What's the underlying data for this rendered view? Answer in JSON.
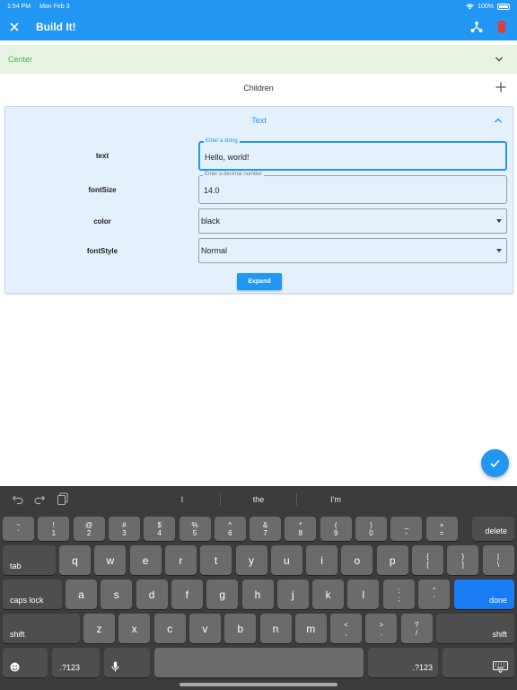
{
  "status_bar": {
    "time": "1:54 PM",
    "date": "Mon Feb 3",
    "battery": "100%"
  },
  "app_bar": {
    "title": "Build It!"
  },
  "center": {
    "label": "Center"
  },
  "children": {
    "label": "Children"
  },
  "text_panel": {
    "title": "Text",
    "props": [
      {
        "label": "text",
        "float": "Enter a string",
        "value": "Hello, world!"
      },
      {
        "label": "fontSize",
        "float": "Enter a decimal number",
        "value": "14.0"
      },
      {
        "label": "color",
        "value": "black"
      },
      {
        "label": "fontStyle",
        "value": "Normal"
      }
    ],
    "expand_label": "Expand"
  },
  "keyboard": {
    "suggestions": [
      "I",
      "the",
      "I'm"
    ],
    "row1": [
      {
        "top": "~",
        "bottom": "`"
      },
      {
        "top": "!",
        "bottom": "1"
      },
      {
        "top": "@",
        "bottom": "2"
      },
      {
        "top": "#",
        "bottom": "3"
      },
      {
        "top": "$",
        "bottom": "4"
      },
      {
        "top": "%",
        "bottom": "5"
      },
      {
        "top": "^",
        "bottom": "6"
      },
      {
        "top": "&",
        "bottom": "7"
      },
      {
        "top": "*",
        "bottom": "8"
      },
      {
        "top": "(",
        "bottom": "9"
      },
      {
        "top": ")",
        "bottom": "0"
      },
      {
        "top": "_",
        "bottom": "-"
      },
      {
        "top": "+",
        "bottom": "="
      }
    ],
    "delete": "delete",
    "tab": "tab",
    "row2": [
      "q",
      "w",
      "e",
      "r",
      "t",
      "y",
      "u",
      "i",
      "o",
      "p"
    ],
    "row2_sym": [
      {
        "top": "{",
        "bottom": "["
      },
      {
        "top": "}",
        "bottom": "]"
      },
      {
        "top": "|",
        "bottom": "\\"
      }
    ],
    "caps": "caps lock",
    "row3": [
      "a",
      "s",
      "d",
      "f",
      "g",
      "h",
      "j",
      "k",
      "l"
    ],
    "row3_sym": [
      {
        "top": ":",
        "bottom": ";"
      },
      {
        "top": "\"",
        "bottom": "'"
      }
    ],
    "done": "done",
    "shift": "shift",
    "row4": [
      "z",
      "x",
      "c",
      "v",
      "b",
      "n",
      "m"
    ],
    "row4_sym": [
      {
        "top": "<",
        "bottom": ","
      },
      {
        "top": ">",
        "bottom": "."
      },
      {
        "top": "?",
        "bottom": "/"
      }
    ],
    "numbers": ".?123"
  }
}
